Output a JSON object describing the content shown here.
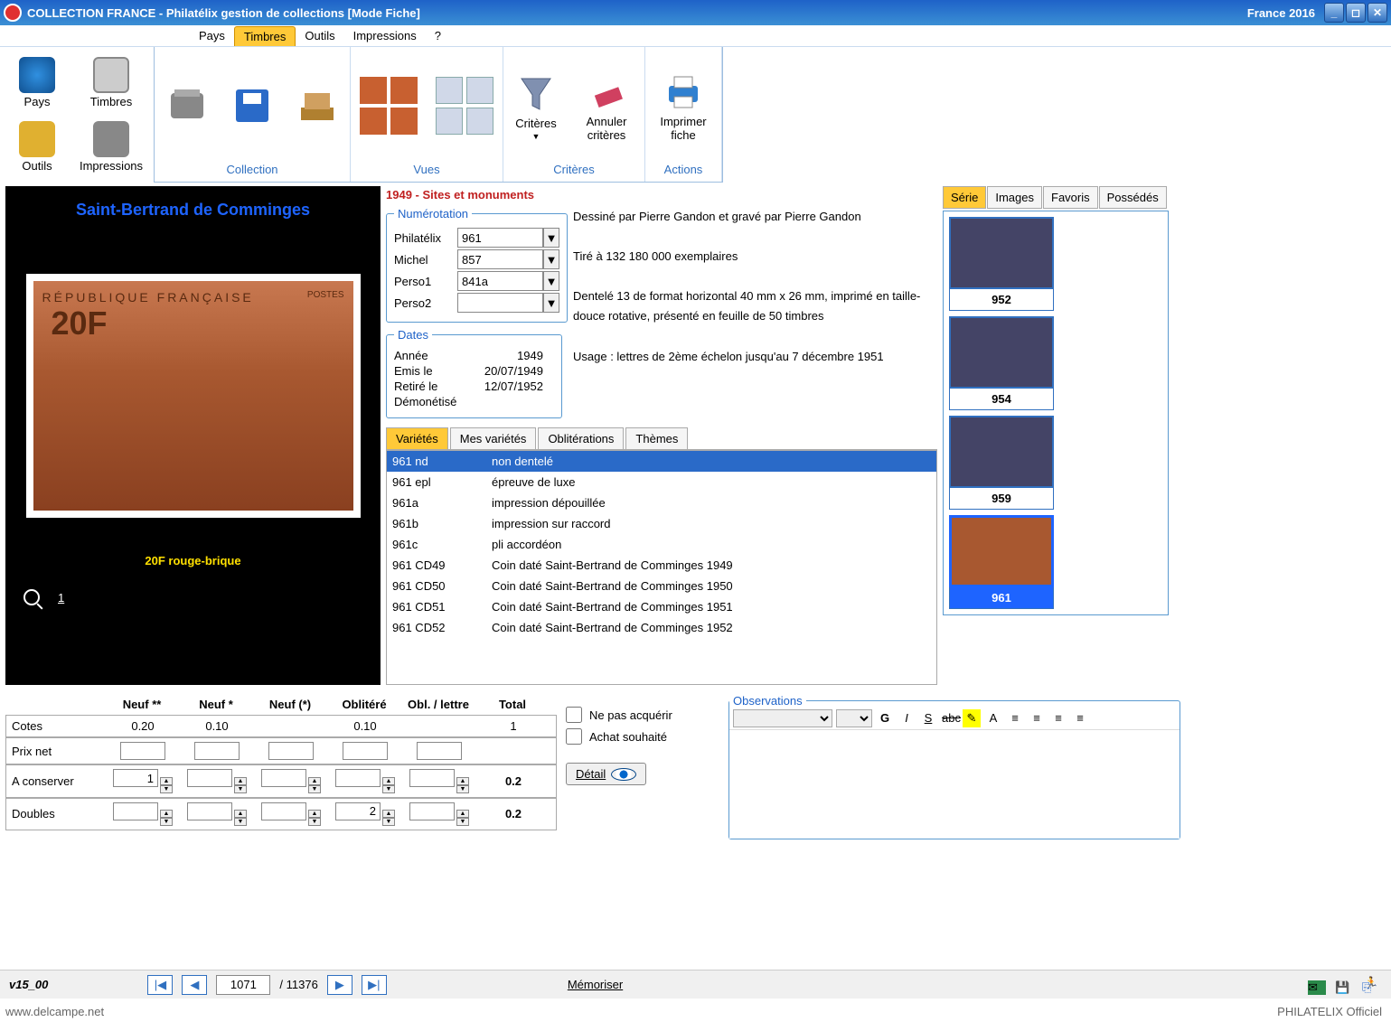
{
  "titlebar": {
    "title": "COLLECTION FRANCE - Philatélix gestion de collections [Mode Fiche]",
    "right": "France 2016"
  },
  "menu": {
    "pays": "Pays",
    "timbres": "Timbres",
    "outils": "Outils",
    "impressions": "Impressions",
    "help": "?"
  },
  "quick": {
    "pays": "Pays",
    "timbres": "Timbres",
    "outils": "Outils",
    "impressions": "Impressions"
  },
  "ribbon": {
    "collection": {
      "label": "Collection"
    },
    "vues": {
      "label": "Vues"
    },
    "criteres": {
      "label": "Critères",
      "btn": "Critères",
      "annuler": "Annuler critères"
    },
    "actions": {
      "label": "Actions",
      "imprimer": "Imprimer fiche"
    }
  },
  "series_title": "1949 - Sites et monuments",
  "stamp": {
    "title": "Saint-Bertrand de Comminges",
    "header": "RÉPUBLIQUE  FRANÇAISE",
    "postes": "POSTES",
    "value": "20F",
    "caption": "20F rouge-brique",
    "zoom": "1"
  },
  "numerotation": {
    "legend": "Numérotation",
    "philatelix_label": "Philatélix",
    "philatelix": "961",
    "michel_label": "Michel",
    "michel": "857",
    "perso1_label": "Perso1",
    "perso1": "841a",
    "perso2_label": "Perso2",
    "perso2": ""
  },
  "dates": {
    "legend": "Dates",
    "annee_label": "Année",
    "annee": "1949",
    "emis_label": "Emis le",
    "emis": "20/07/1949",
    "retire_label": "Retiré le",
    "retire": "12/07/1952",
    "demon_label": "Démonétisé",
    "demon": ""
  },
  "description": {
    "l1": "Dessiné par Pierre Gandon et gravé par Pierre Gandon",
    "l2": "Tiré à 132 180 000 exemplaires",
    "l3": "Dentelé 13 de format horizontal 40 mm x 26 mm, imprimé en taille-douce rotative, présenté en feuille de 50 timbres",
    "l4": "Usage : lettres de 2ème échelon jusqu'au 7 décembre 1951"
  },
  "vartabs": {
    "varietes": "Variétés",
    "mes": "Mes variétés",
    "obl": "Oblitérations",
    "themes": "Thèmes"
  },
  "varieties": [
    {
      "code": "961 nd",
      "desc": "non dentelé"
    },
    {
      "code": "961 epl",
      "desc": "épreuve de luxe"
    },
    {
      "code": "961a",
      "desc": "impression dépouillée"
    },
    {
      "code": "961b",
      "desc": "impression sur raccord"
    },
    {
      "code": "961c",
      "desc": "pli accordéon"
    },
    {
      "code": "961 CD49",
      "desc": "Coin daté Saint-Bertrand de Comminges 1949"
    },
    {
      "code": "961 CD50",
      "desc": "Coin daté Saint-Bertrand de Comminges 1950"
    },
    {
      "code": "961 CD51",
      "desc": "Coin daté Saint-Bertrand de Comminges 1951"
    },
    {
      "code": "961 CD52",
      "desc": "Coin daté Saint-Bertrand de Comminges 1952"
    }
  ],
  "righttabs": {
    "serie": "Série",
    "images": "Images",
    "favoris": "Favoris",
    "possedes": "Possédés"
  },
  "thumbs": [
    {
      "n": "952"
    },
    {
      "n": "954"
    },
    {
      "n": "959"
    },
    {
      "n": "961"
    }
  ],
  "tablehead": {
    "c0": "",
    "neuf2": "Neuf **",
    "neuf1": "Neuf *",
    "neufp": "Neuf (*)",
    "obl": "Oblitéré",
    "obll": "Obl. / lettre",
    "total": "Total"
  },
  "rows": {
    "cotes": {
      "label": "Cotes",
      "neuf2": "0.20",
      "neuf1": "0.10",
      "neufp": "",
      "obl": "0.10",
      "obll": "",
      "total": "1"
    },
    "prix": {
      "label": "Prix net"
    },
    "cons": {
      "label": "A conserver",
      "neuf2": "1",
      "total": "0.2"
    },
    "doubles": {
      "label": "Doubles",
      "obl": "2",
      "total": "0.2"
    }
  },
  "checks": {
    "nepas": "Ne pas acquérir",
    "achat": "Achat souhaité",
    "detail": "Détail"
  },
  "obs": {
    "legend": "Observations"
  },
  "status": {
    "version": "v15_00",
    "current": "1071",
    "total": "/ 11376",
    "memoriser": "Mémoriser"
  },
  "footer": {
    "watermark": "www.delcampe.net",
    "brand": "PHILATELIX Officiel"
  }
}
